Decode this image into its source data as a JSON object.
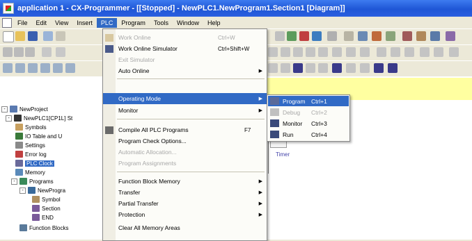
{
  "window": {
    "title": "application 1 - CX-Programmer - [[Stopped] - NewPLC1.NewProgram1.Section1 [Diagram]]"
  },
  "menubar": {
    "items": [
      "File",
      "Edit",
      "View",
      "Insert",
      "PLC",
      "Program",
      "Tools",
      "Window",
      "Help"
    ],
    "active": "PLC"
  },
  "plc_menu": {
    "items": [
      {
        "label": "Work Online",
        "shortcut": "Ctrl+W",
        "disabled": true
      },
      {
        "label": "Work Online Simulator",
        "shortcut": "Ctrl+Shift+W",
        "disabled": false
      },
      {
        "label": "Exit Simulator",
        "shortcut": "",
        "disabled": true
      },
      {
        "label": "Auto Online",
        "shortcut": "",
        "disabled": false,
        "submenu": true
      },
      {
        "label": "Operating Mode",
        "shortcut": "",
        "disabled": false,
        "submenu": true,
        "highlighted": true
      },
      {
        "label": "Monitor",
        "shortcut": "",
        "disabled": false,
        "submenu": true
      },
      {
        "label": "Compile All PLC Programs",
        "shortcut": "F7",
        "disabled": false
      },
      {
        "label": "Program Check Options...",
        "shortcut": "",
        "disabled": false
      },
      {
        "label": "Automatic Allocation...",
        "shortcut": "",
        "disabled": true
      },
      {
        "label": "Program Assignments",
        "shortcut": "",
        "disabled": true
      },
      {
        "label": "Function Block Memory",
        "shortcut": "",
        "disabled": false,
        "submenu": true
      },
      {
        "label": "Transfer",
        "shortcut": "",
        "disabled": false,
        "submenu": true
      },
      {
        "label": "Partial Transfer",
        "shortcut": "",
        "disabled": false,
        "submenu": true
      },
      {
        "label": "Protection",
        "shortcut": "",
        "disabled": false,
        "submenu": true
      },
      {
        "label": "Clear All Memory Areas",
        "shortcut": "",
        "disabled": false
      }
    ]
  },
  "operating_mode_submenu": {
    "items": [
      {
        "label": "Program",
        "shortcut": "Ctrl+1",
        "highlighted": true,
        "disabled": false
      },
      {
        "label": "Debug",
        "shortcut": "Ctrl+2",
        "disabled": true
      },
      {
        "label": "Monitor",
        "shortcut": "Ctrl+3",
        "disabled": false
      },
      {
        "label": "Run",
        "shortcut": "Ctrl+4",
        "disabled": false
      }
    ]
  },
  "tree": {
    "nodes": [
      {
        "label": "NewProject",
        "icon": "project-icon"
      },
      {
        "label": "NewPLC1[CP1L] St",
        "icon": "plc-icon"
      },
      {
        "label": "Symbols",
        "icon": "symbols-icon"
      },
      {
        "label": "IO Table and U",
        "icon": "io-table-icon"
      },
      {
        "label": "Settings",
        "icon": "settings-icon"
      },
      {
        "label": "Error log",
        "icon": "error-log-icon"
      },
      {
        "label": "PLC Clock",
        "icon": "clock-icon",
        "selected": true
      },
      {
        "label": "Memory",
        "icon": "memory-icon"
      },
      {
        "label": "Programs",
        "icon": "programs-icon"
      },
      {
        "label": "NewProgra",
        "icon": "program-icon"
      },
      {
        "label": "Symbol",
        "icon": "symbol-icon"
      },
      {
        "label": "Section",
        "icon": "section-icon"
      },
      {
        "label": "END",
        "icon": "end-icon"
      },
      {
        "label": "Function Blocks",
        "icon": "function-blocks-icon"
      }
    ]
  },
  "diagram": {
    "timer_label": "Timer"
  }
}
